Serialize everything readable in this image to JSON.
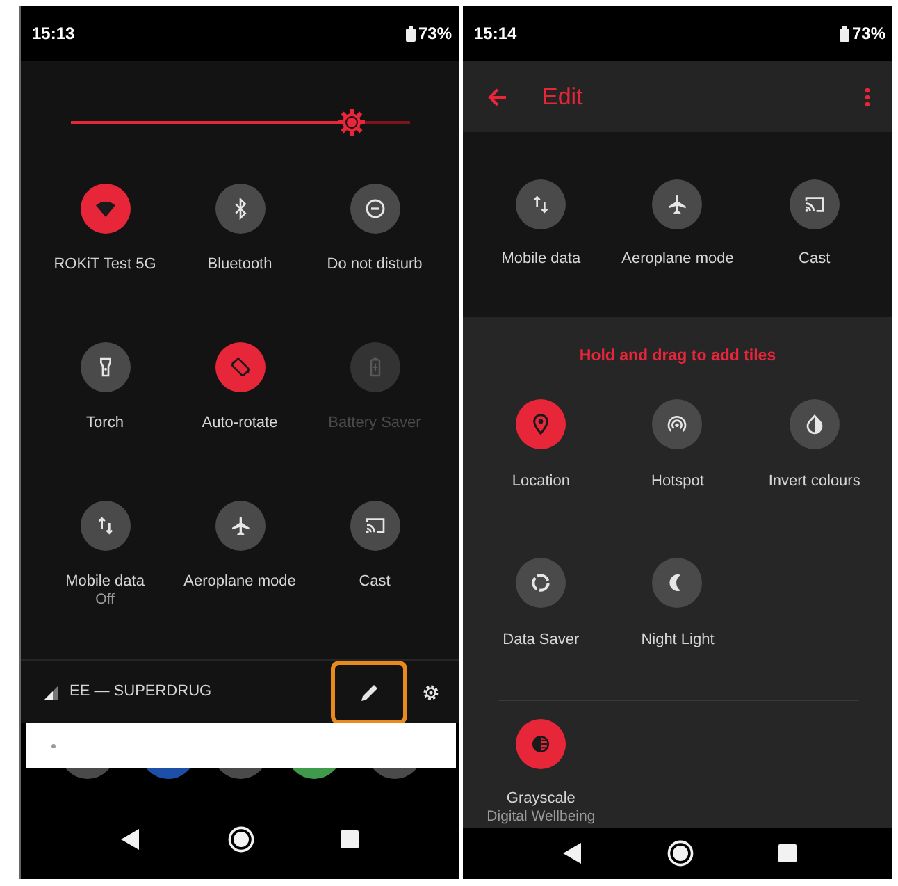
{
  "left_screen": {
    "status_bar": {
      "time": "15:13",
      "battery": "73%"
    },
    "brightness": {
      "level": 0.83
    },
    "tiles": [
      {
        "label": "ROKiT Test 5G",
        "on": true,
        "disabled": false
      },
      {
        "label": "Bluetooth",
        "on": false,
        "disabled": false
      },
      {
        "label": "Do not disturb",
        "on": false,
        "disabled": false
      },
      {
        "label": "Torch",
        "on": false,
        "disabled": false
      },
      {
        "label": "Auto-rotate",
        "on": true,
        "disabled": false
      },
      {
        "label": "Battery Saver",
        "on": false,
        "disabled": true
      },
      {
        "label": "Mobile data",
        "sublabel": "Off",
        "on": false,
        "disabled": false
      },
      {
        "label": "Aeroplane mode",
        "on": false,
        "disabled": false
      },
      {
        "label": "Cast",
        "on": false,
        "disabled": false
      }
    ],
    "carrier": "EE — SUPERDRUG",
    "edit_button": {
      "highlighted": true
    }
  },
  "right_screen": {
    "status_bar": {
      "time": "15:14",
      "battery": "73%"
    },
    "title": "Edit",
    "current_tiles": [
      {
        "label": "Mobile data",
        "on": false
      },
      {
        "label": "Aeroplane mode",
        "on": false
      },
      {
        "label": "Cast",
        "on": false
      }
    ],
    "hint": "Hold and drag to add tiles",
    "available_tiles": [
      {
        "label": "Location",
        "on": true
      },
      {
        "label": "Hotspot",
        "on": false
      },
      {
        "label": "Invert colours",
        "on": false
      },
      {
        "label": "Data Saver",
        "on": false
      },
      {
        "label": "Night Light",
        "on": false
      }
    ],
    "other_tiles": [
      {
        "label": "Grayscale",
        "sublabel": "Digital Wellbeing",
        "on": true
      }
    ]
  }
}
